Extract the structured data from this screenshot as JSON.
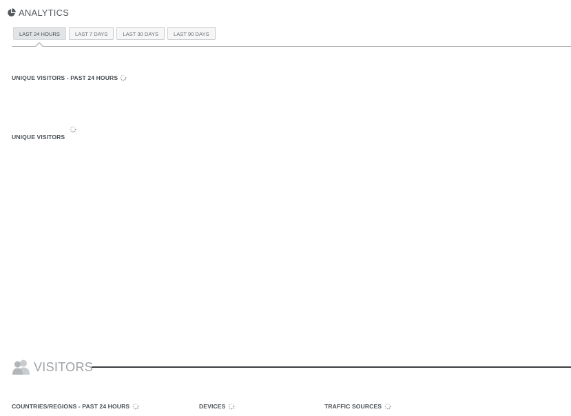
{
  "header": {
    "title": "ANALYTICS",
    "icon": "pie-chart-icon"
  },
  "tabs": [
    {
      "label": "LAST 24 HOURS",
      "active": true
    },
    {
      "label": "LAST 7 DAYS",
      "active": false
    },
    {
      "label": "LAST 30 DAYS",
      "active": false
    },
    {
      "label": "LAST 90 DAYS",
      "active": false
    }
  ],
  "sections": {
    "unique_visitors_24h": "UNIQUE VISITORS - PAST 24 HOURS",
    "unique_visitors": "UNIQUE VISITORS"
  },
  "visitors": {
    "title": "VISITORS",
    "icon": "users-icon",
    "panels": {
      "countries": "COUNTRIES/REGIONS - PAST 24 HOURS",
      "devices": "DEVICES",
      "traffic_sources": "TRAFFIC SOURCES"
    }
  },
  "colors": {
    "text_dark": "#4a4f54",
    "text_muted": "#9ea2a6",
    "rule": "#b5b8bb",
    "tab_active_bg": "#e2e4e6"
  }
}
